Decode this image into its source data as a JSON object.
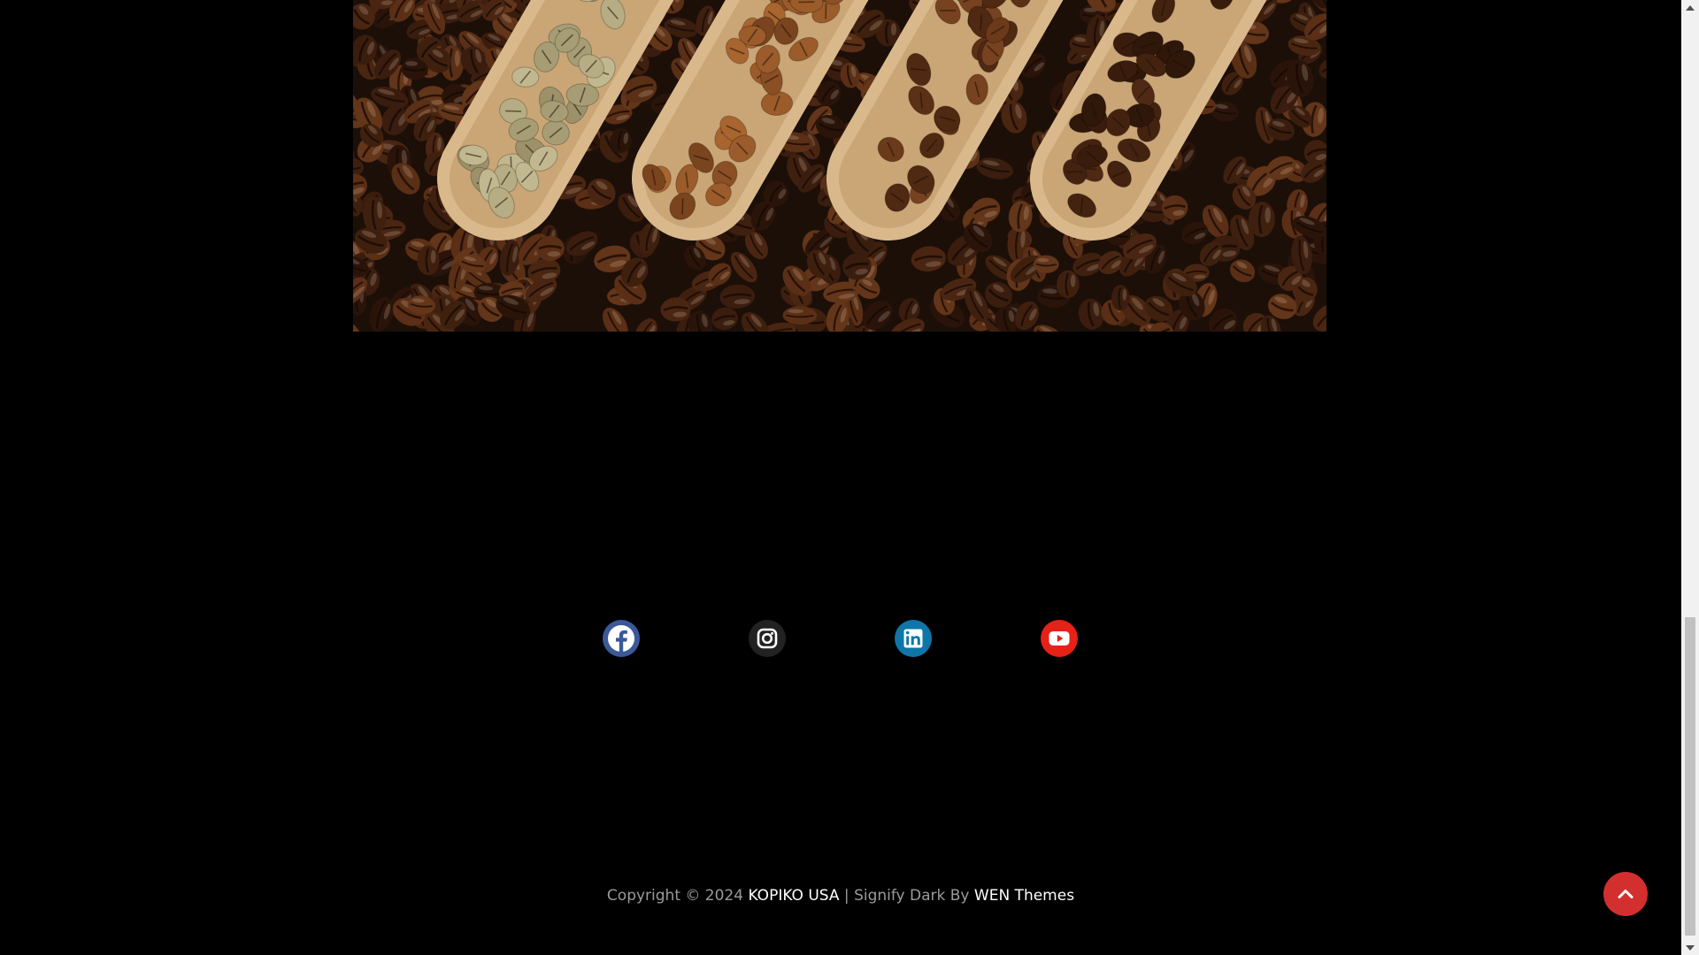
{
  "hero": {
    "image_subject": "coffee-beans-in-wooden-scoops"
  },
  "social": {
    "links": [
      {
        "name": "facebook",
        "icon": "facebook-icon",
        "color": "#3b5998"
      },
      {
        "name": "instagram",
        "icon": "instagram-icon",
        "color": "#222222"
      },
      {
        "name": "linkedin",
        "icon": "linkedin-icon",
        "color": "#0e76a8"
      },
      {
        "name": "youtube",
        "icon": "youtube-icon",
        "color": "#e62117"
      }
    ]
  },
  "footer": {
    "copyright_prefix": "Copyright © 2024",
    "site_name": "KOPIKO USA",
    "separator": "|",
    "theme_text": "Signify Dark By",
    "theme_author": "WEN Themes"
  },
  "scroll_top": {
    "icon": "chevron-up-icon",
    "color": "#d32f2f"
  },
  "colors": {
    "background": "#000000",
    "footer_text": "#9a9a9a",
    "link_text": "#ffffff"
  }
}
